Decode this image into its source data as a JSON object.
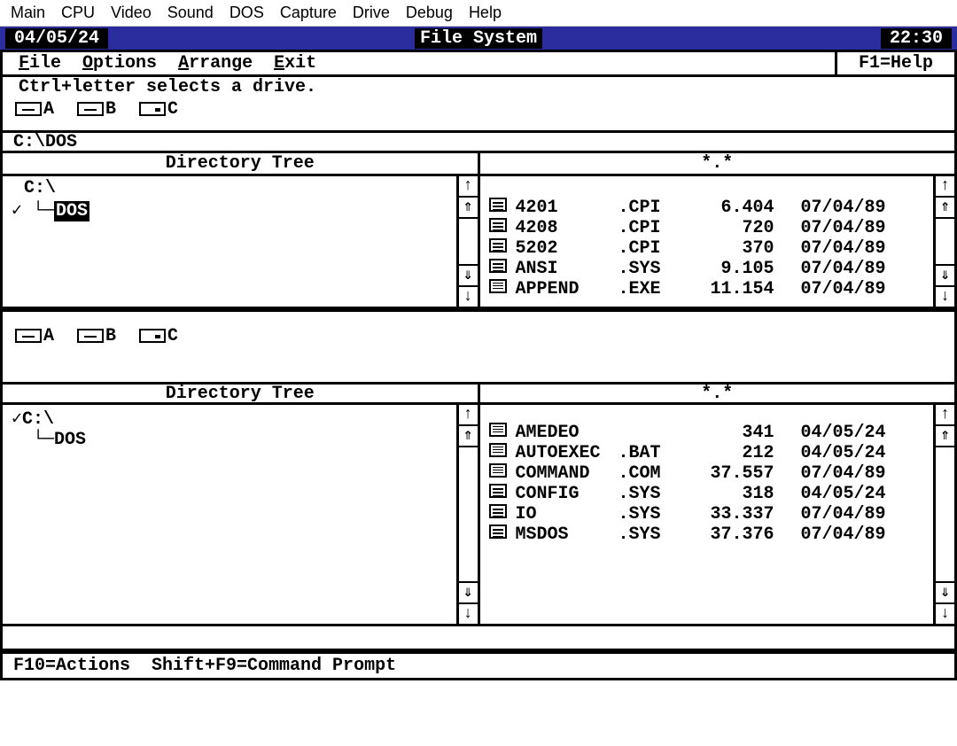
{
  "host_menu": [
    "Main",
    "CPU",
    "Video",
    "Sound",
    "DOS",
    "Capture",
    "Drive",
    "Debug",
    "Help"
  ],
  "titlebar": {
    "date": "04/05/24",
    "title": "File System",
    "time": "22:30"
  },
  "menubar": {
    "items": [
      {
        "u": "F",
        "rest": "ile"
      },
      {
        "u": "O",
        "rest": "ptions"
      },
      {
        "u": "A",
        "rest": "rrange"
      },
      {
        "u": "E",
        "rest": "xit"
      }
    ],
    "help": "F1=Help"
  },
  "drive_hint": "Ctrl+letter selects a drive.",
  "drives": [
    {
      "letter": "A",
      "type": "slot"
    },
    {
      "letter": "B",
      "type": "slot"
    },
    {
      "letter": "C",
      "type": "hd"
    }
  ],
  "top": {
    "path": "C:\\DOS",
    "tree_header": "Directory Tree",
    "filter_header": "*.*",
    "tree": {
      "root": "C:\\",
      "child": "DOS",
      "child_selected": true,
      "root_checked": false,
      "child_checked": true
    },
    "files": [
      {
        "icon": "doc",
        "name": "4201",
        "ext": ".CPI",
        "size": "6.404",
        "date": "07/04/89"
      },
      {
        "icon": "doc",
        "name": "4208",
        "ext": ".CPI",
        "size": "720",
        "date": "07/04/89"
      },
      {
        "icon": "doc",
        "name": "5202",
        "ext": ".CPI",
        "size": "370",
        "date": "07/04/89"
      },
      {
        "icon": "doc",
        "name": "ANSI",
        "ext": ".SYS",
        "size": "9.105",
        "date": "07/04/89"
      },
      {
        "icon": "exe",
        "name": "APPEND",
        "ext": ".EXE",
        "size": "11.154",
        "date": "07/04/89"
      }
    ]
  },
  "bottom": {
    "tree_header": "Directory Tree",
    "filter_header": "*.*",
    "tree": {
      "root": "C:\\",
      "child": "DOS",
      "child_selected": false,
      "root_checked": true,
      "child_checked": false
    },
    "files": [
      {
        "icon": "exe",
        "name": "AMEDEO",
        "ext": "",
        "size": "341",
        "date": "04/05/24"
      },
      {
        "icon": "exe",
        "name": "AUTOEXEC",
        "ext": ".BAT",
        "size": "212",
        "date": "04/05/24"
      },
      {
        "icon": "exe",
        "name": "COMMAND",
        "ext": ".COM",
        "size": "37.557",
        "date": "07/04/89"
      },
      {
        "icon": "doc",
        "name": "CONFIG",
        "ext": ".SYS",
        "size": "318",
        "date": "04/05/24"
      },
      {
        "icon": "doc",
        "name": "IO",
        "ext": ".SYS",
        "size": "33.337",
        "date": "07/04/89"
      },
      {
        "icon": "doc",
        "name": "MSDOS",
        "ext": ".SYS",
        "size": "37.376",
        "date": "07/04/89"
      }
    ]
  },
  "statusbar": "F10=Actions  Shift+F9=Command Prompt"
}
